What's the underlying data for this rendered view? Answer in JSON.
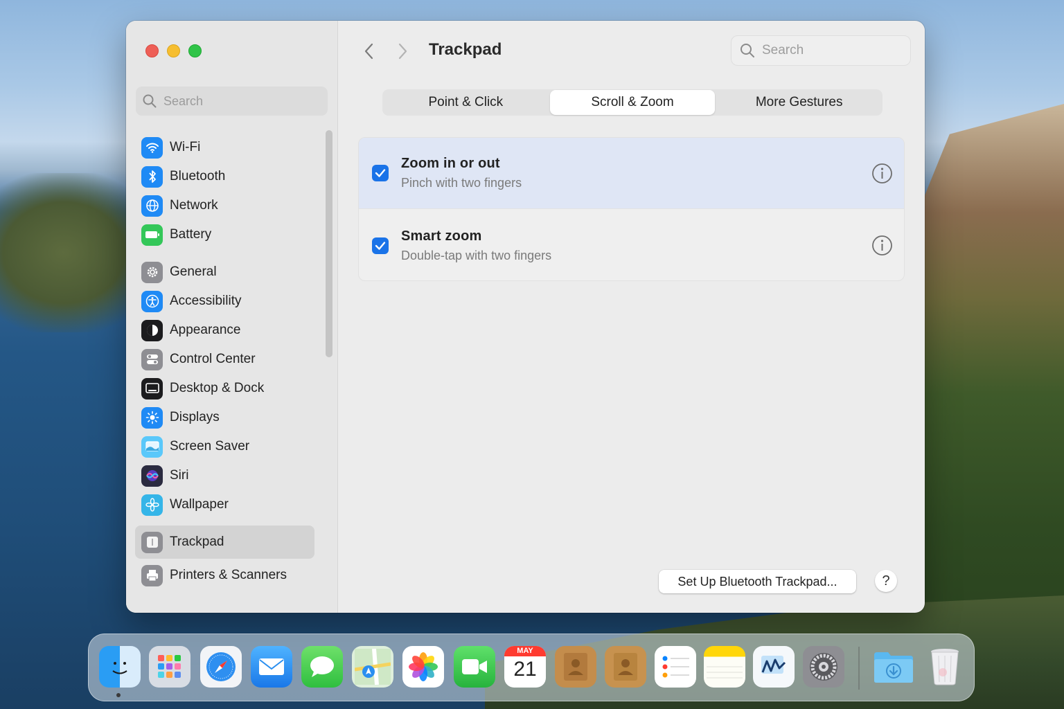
{
  "window": {
    "title": "Trackpad"
  },
  "sidebar": {
    "search_placeholder": "Search",
    "items": [
      {
        "label": "Wi-Fi",
        "icon": "wifi-icon",
        "color": "#1f8af5"
      },
      {
        "label": "Bluetooth",
        "icon": "bluetooth-icon",
        "color": "#1f8af5"
      },
      {
        "label": "Network",
        "icon": "globe-icon",
        "color": "#1f8af5"
      },
      {
        "label": "Battery",
        "icon": "battery-icon",
        "color": "#34c759"
      },
      {
        "label": "General",
        "icon": "gear-icon",
        "color": "#8e8e93"
      },
      {
        "label": "Accessibility",
        "icon": "accessibility-icon",
        "color": "#1f8af5"
      },
      {
        "label": "Appearance",
        "icon": "appearance-icon",
        "color": "#1c1c1e"
      },
      {
        "label": "Control Center",
        "icon": "control-center-icon",
        "color": "#8e8e93"
      },
      {
        "label": "Desktop & Dock",
        "icon": "desktop-dock-icon",
        "color": "#1c1c1e"
      },
      {
        "label": "Displays",
        "icon": "sun-icon",
        "color": "#1f8af5"
      },
      {
        "label": "Screen Saver",
        "icon": "screen-saver-icon",
        "color": "#5ac8fa"
      },
      {
        "label": "Siri",
        "icon": "siri-icon",
        "color": "#2b2b40"
      },
      {
        "label": "Wallpaper",
        "icon": "flower-icon",
        "color": "#35b5e8"
      },
      {
        "label": "Trackpad",
        "icon": "trackpad-icon",
        "color": "#8e8e93",
        "selected": true
      },
      {
        "label": "Printers & Scanners",
        "icon": "printer-icon",
        "color": "#8e8e93"
      }
    ]
  },
  "header": {
    "search_placeholder": "Search"
  },
  "tabs": [
    {
      "label": "Point & Click",
      "active": false
    },
    {
      "label": "Scroll & Zoom",
      "active": true
    },
    {
      "label": "More Gestures",
      "active": false
    }
  ],
  "settings": [
    {
      "title": "Zoom in or out",
      "subtitle": "Pinch with two fingers",
      "checked": true
    },
    {
      "title": "Smart zoom",
      "subtitle": "Double-tap with two fingers",
      "checked": true
    }
  ],
  "footer": {
    "setup_button": "Set Up Bluetooth Trackpad...",
    "help_button": "?"
  },
  "dock": {
    "calendar_month": "MAY",
    "calendar_day": "21",
    "apps": [
      "finder-icon",
      "launchpad-icon",
      "safari-icon",
      "mail-icon",
      "messages-icon",
      "maps-icon",
      "photos-icon",
      "facetime-icon",
      "calendar-icon",
      "contacts-icon",
      "contacts-alt-icon",
      "reminders-icon",
      "notes-icon",
      "freeform-icon",
      "system-settings-icon",
      "downloads-folder-icon",
      "trash-icon"
    ]
  },
  "colors": {
    "accent": "#1a73e8",
    "selected_row": "#dfe6f5"
  }
}
